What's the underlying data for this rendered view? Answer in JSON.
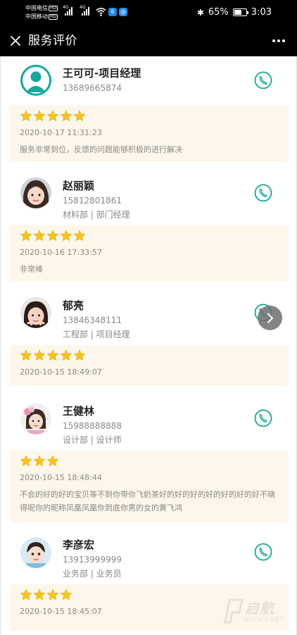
{
  "status_bar": {
    "carrier1": "中国电信",
    "carrier2": "中国移动",
    "hd_label": "HD",
    "net_label": "4G",
    "battery": "65%",
    "battery_level": 0.65,
    "time": "3:03"
  },
  "nav": {
    "title": "服务评价",
    "close_icon": "close-icon",
    "more_icon": "more-icon"
  },
  "colors": {
    "accent": "#16a79d",
    "star": "#f8c41a",
    "review_bg": "#fdf6ea"
  },
  "entries": [
    {
      "name": "王可可-项目经理",
      "phone": "13689665874",
      "dept": "",
      "avatar": "default-avatar-icon",
      "rating": 5,
      "date": "2020-10-17 11:31:23",
      "comment": "服务非常到位，反馈的问题能够积极的进行解决"
    },
    {
      "name": "赵丽颖",
      "phone": "15812801861",
      "dept": "材料部 | 部门经理",
      "avatar": "child-photo-avatar",
      "rating": 5,
      "date": "2020-10-16 17:33:57",
      "comment": "非常棒"
    },
    {
      "name": "郁亮",
      "phone": "13846348111",
      "dept": "工程部 | 项目经理",
      "avatar": "child-photo-avatar",
      "rating": 5,
      "date": "2020-10-15 18:49:07",
      "comment": ""
    },
    {
      "name": "王健林",
      "phone": "15988888888",
      "dept": "设计部 | 设计师",
      "avatar": "child-photo-avatar",
      "rating": 3,
      "date": "2020-10-15 18:48:44",
      "comment": "不会的好的好的宝贝等不到你带你飞奶茶好的好的好的好的好的好的好不晓得呢你的昵称凤凰凤凰你到底你男的女的黄飞鸿"
    },
    {
      "name": "李彦宏",
      "phone": "13913999999",
      "dept": "业务部 | 业务员",
      "avatar": "child-photo-avatar",
      "rating": 4,
      "date": "2020-10-15 18:45:07",
      "comment": ""
    }
  ],
  "watermark": {
    "text": "启航",
    "sub": "DTCMS.NET"
  }
}
